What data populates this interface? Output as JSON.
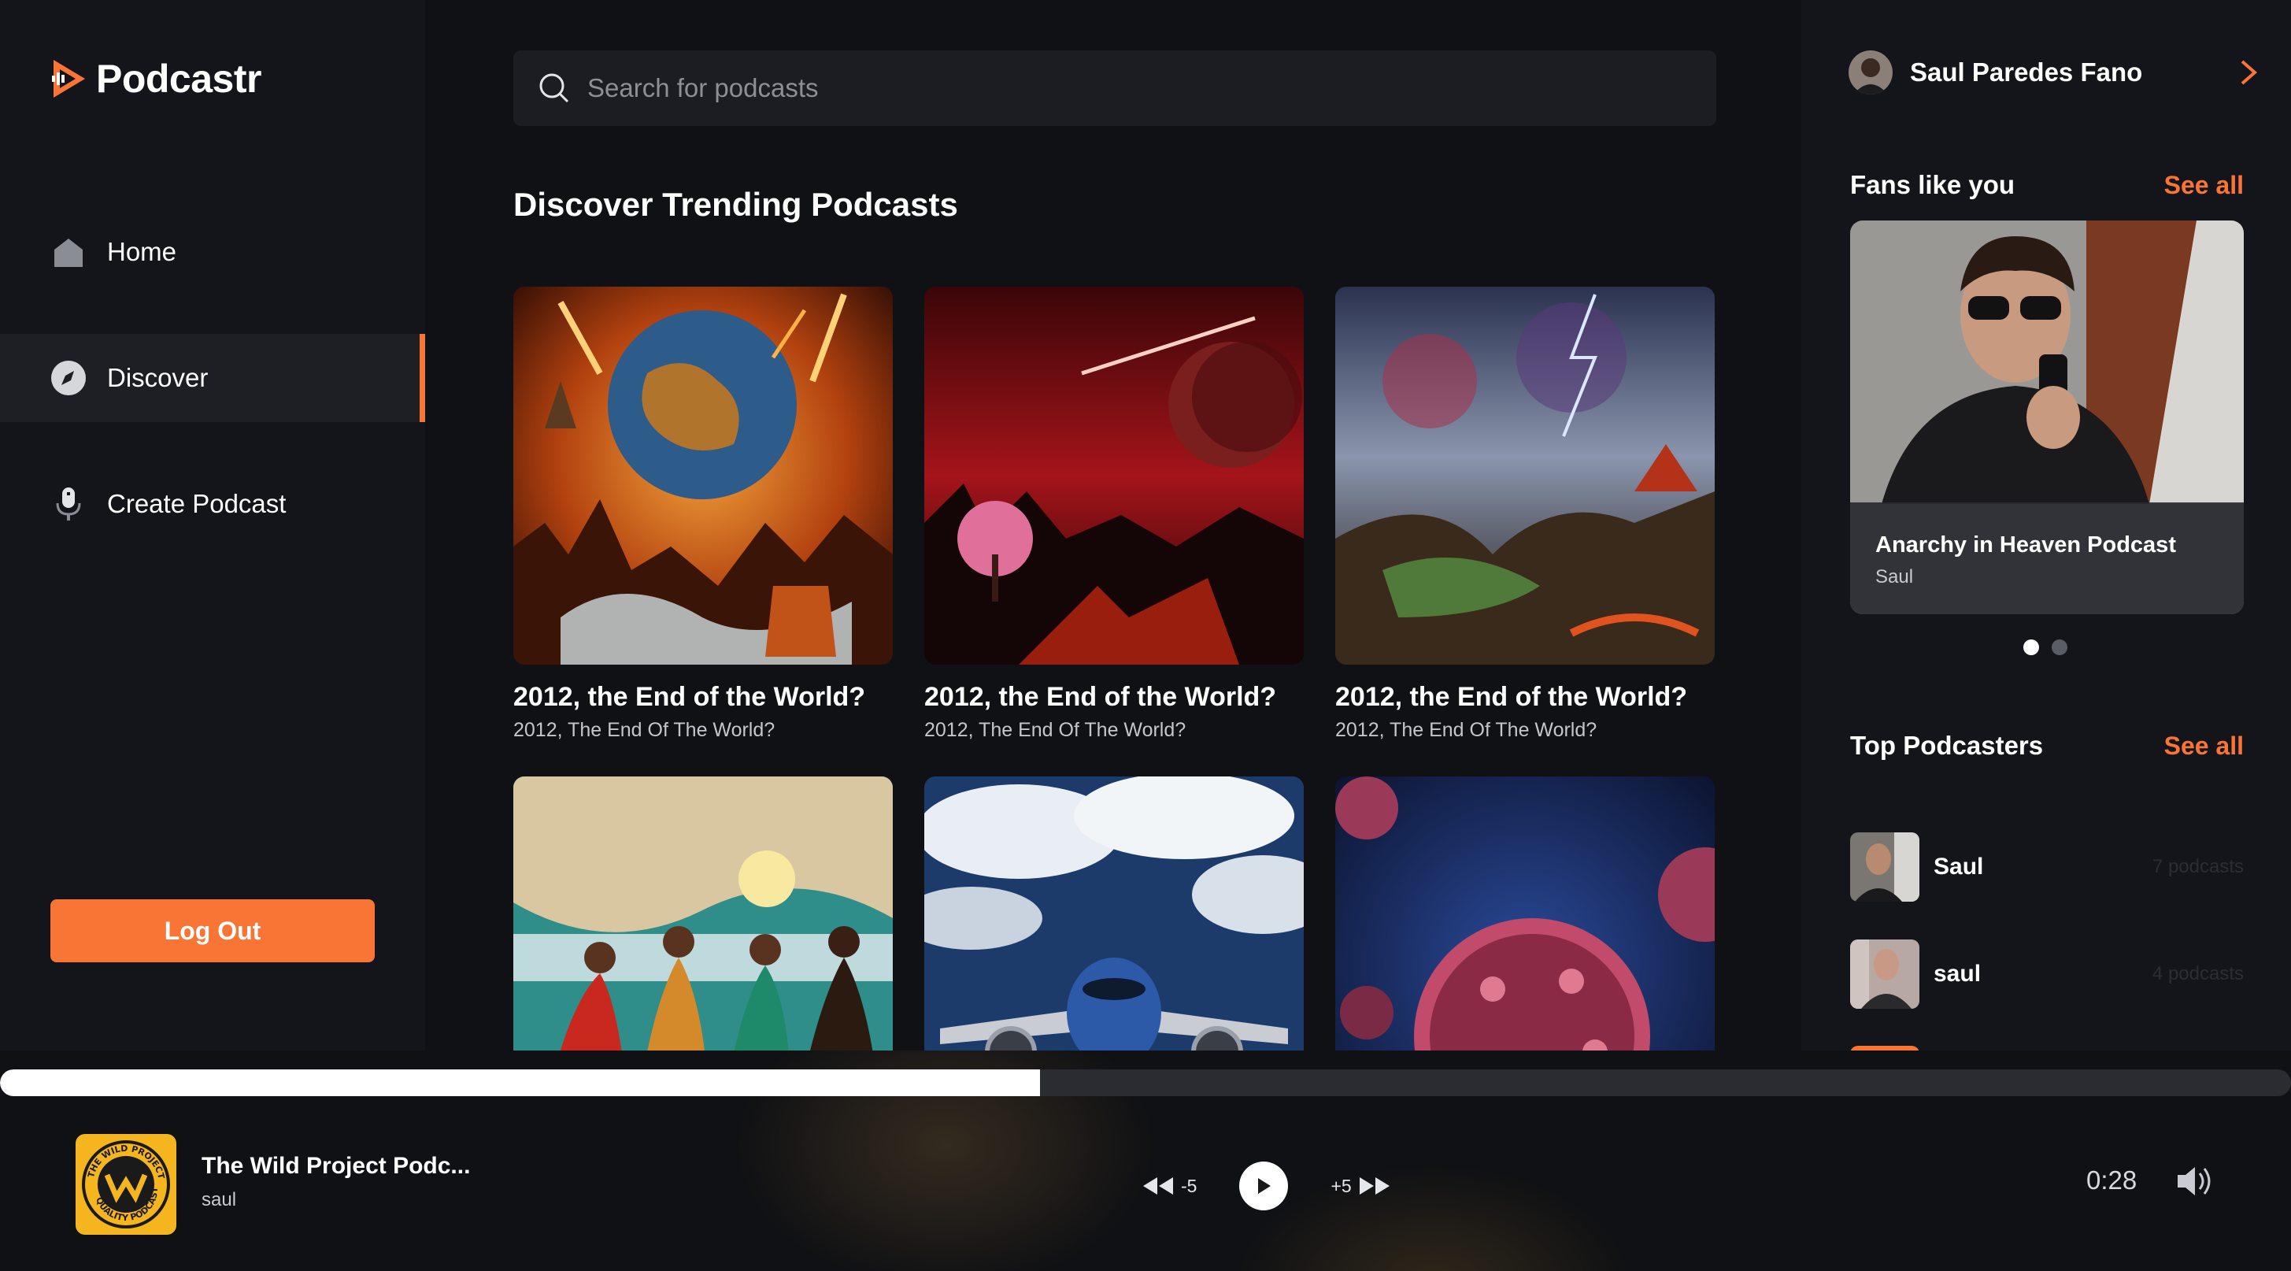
{
  "app": {
    "name": "Podcastr"
  },
  "colors": {
    "accent": "#f97535",
    "background": "#101114",
    "panel": "#13151a"
  },
  "sidebar": {
    "items": [
      {
        "label": "Home",
        "icon": "home-icon"
      },
      {
        "label": "Discover",
        "icon": "compass-icon",
        "active": true
      },
      {
        "label": "Create Podcast",
        "icon": "microphone-icon"
      }
    ],
    "logout_label": "Log Out"
  },
  "search": {
    "placeholder": "Search for podcasts",
    "value": ""
  },
  "main": {
    "section_title": "Discover Trending Podcasts",
    "cards": [
      {
        "title": "2012, the End of the World?",
        "subtitle": "2012, The End Of The World?"
      },
      {
        "title": "2012, the End of the World?",
        "subtitle": "2012, The End Of The World?"
      },
      {
        "title": "2012, the End of the World?",
        "subtitle": "2012, The End Of The World?"
      },
      {
        "title": "",
        "subtitle": ""
      },
      {
        "title": "",
        "subtitle": ""
      },
      {
        "title": "",
        "subtitle": ""
      }
    ]
  },
  "right": {
    "profile_name": "Saul Paredes Fano",
    "fans": {
      "title": "Fans like you",
      "see_all": "See all",
      "card_title": "Anarchy in Heaven Podcast",
      "card_author": "Saul",
      "slides": 2,
      "active_slide": 0
    },
    "top_podcasters": {
      "title": "Top Podcasters",
      "see_all": "See all",
      "items": [
        {
          "name": "Saul",
          "count": "7 podcasts"
        },
        {
          "name": "saul",
          "count": "4 podcasts"
        }
      ]
    }
  },
  "player": {
    "title": "The Wild Project Podc...",
    "author": "saul",
    "rewind_label": "-5",
    "forward_label": "+5",
    "time": "0:28",
    "progress": 0.454,
    "cover_text_top": "THE WILD PROJECT",
    "cover_text_bottom": "QUALITY PODCAST"
  }
}
